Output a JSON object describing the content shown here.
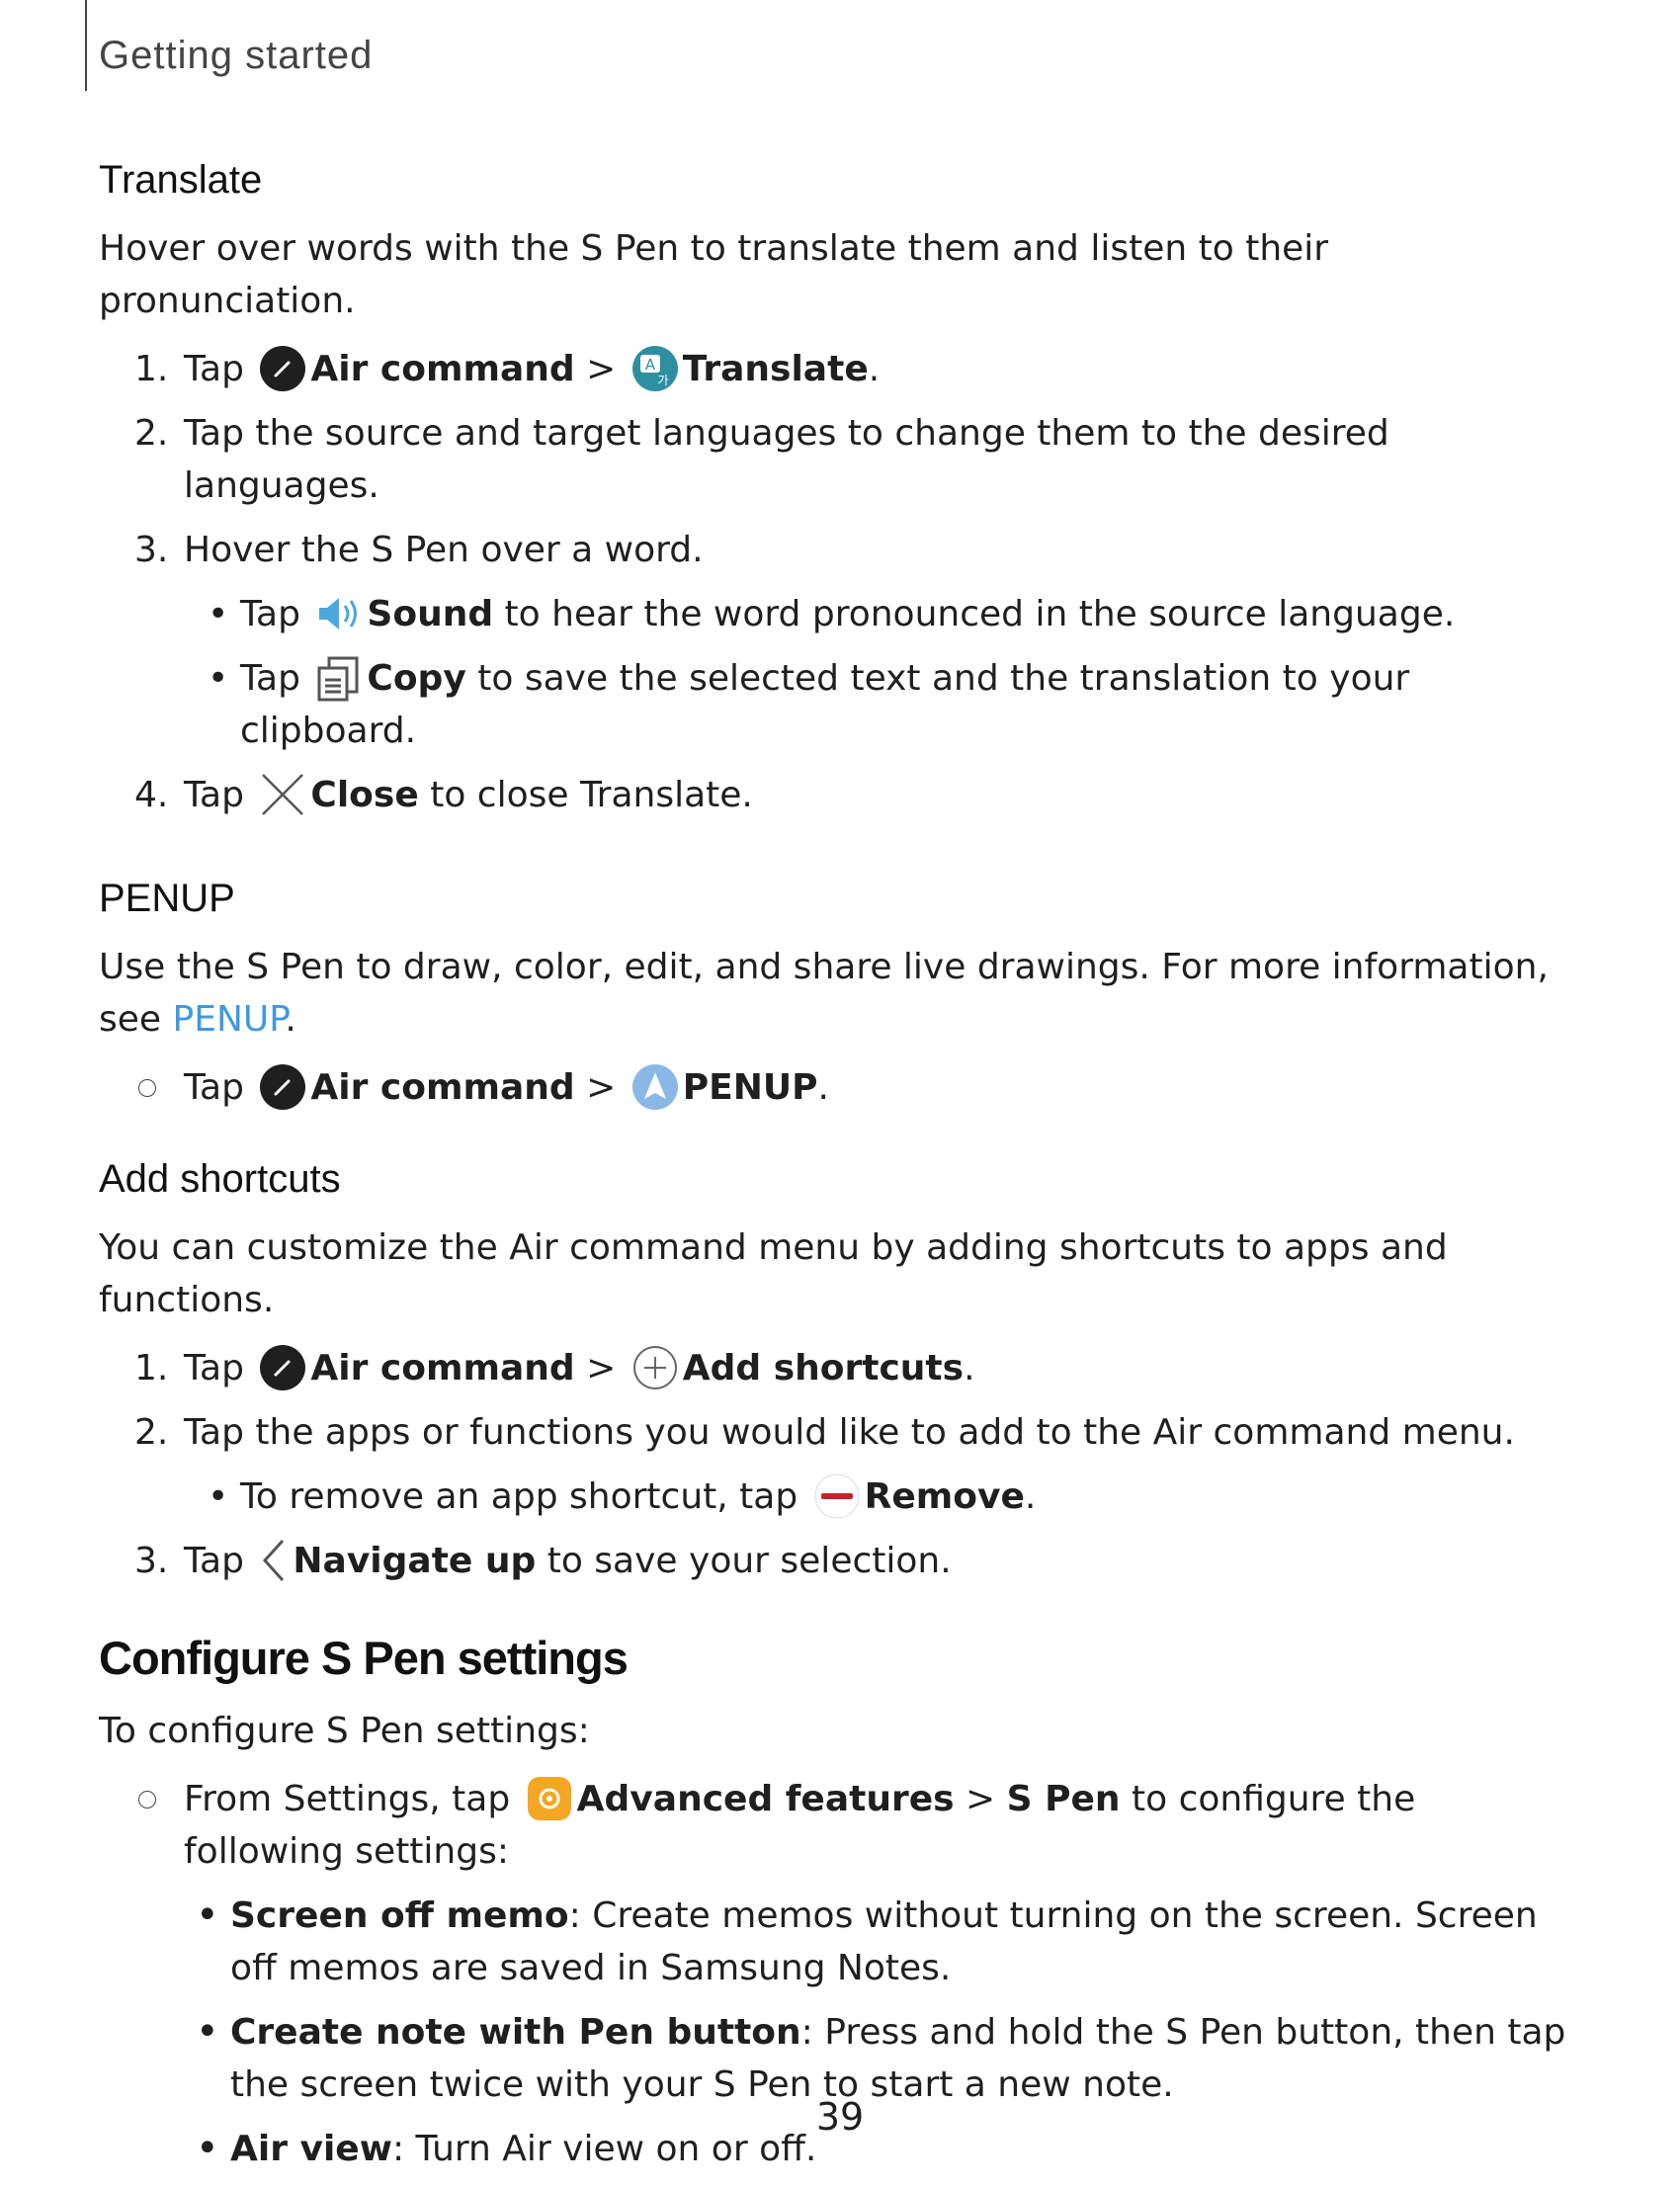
{
  "section_label": "Getting started",
  "translate": {
    "heading": "Translate",
    "intro": "Hover over words with the S Pen to translate them and listen to their pronunciation.",
    "step1": {
      "num": "1.",
      "tap": "Tap",
      "air_command": "Air command",
      "sep": ">",
      "target": "Translate",
      "end": "."
    },
    "step2": {
      "num": "2.",
      "text": "Tap the source and target languages to change them to the desired languages."
    },
    "step3": {
      "num": "3.",
      "text": "Hover the S Pen over a word."
    },
    "bullet_sound": {
      "dot": "•",
      "tap": "Tap",
      "label": "Sound",
      "rest": "to hear the word pronounced in the source language."
    },
    "bullet_copy": {
      "dot": "•",
      "tap": "Tap",
      "label": "Copy",
      "rest": "to save the selected text and the translation to your clipboard."
    },
    "step4": {
      "num": "4.",
      "tap": "Tap",
      "label": "Close",
      "rest": "to close Translate."
    }
  },
  "penup": {
    "heading": "PENUP",
    "intro": "Use the S Pen to draw, color, edit, and share live drawings. For more information, see",
    "link": "PENUP",
    "link_end": ".",
    "step": {
      "tap": "Tap",
      "air_command": "Air command",
      "sep": ">",
      "target": "PENUP",
      "end": "."
    }
  },
  "shortcuts": {
    "heading": "Add shortcuts",
    "intro": "You can customize the Air command menu by adding shortcuts to apps and functions.",
    "step1": {
      "num": "1.",
      "tap": "Tap",
      "air_command": "Air command",
      "sep": ">",
      "target": "Add shortcuts",
      "end": "."
    },
    "step2": {
      "num": "2.",
      "text": "Tap the apps or functions you would like to add to the Air command menu."
    },
    "bullet_remove": {
      "dot": "•",
      "text": "To remove an app shortcut, tap",
      "label": "Remove",
      "end": "."
    },
    "step3": {
      "num": "3.",
      "tap": "Tap",
      "label": "Navigate up",
      "rest": "to save your selection."
    }
  },
  "configure": {
    "heading": "Configure S Pen settings",
    "intro": "To configure S Pen settings:",
    "step": {
      "text": "From Settings, tap",
      "advanced": "Advanced features",
      "sep": ">",
      "spen": "S Pen",
      "rest": "to configure the following settings:"
    },
    "bullets": [
      {
        "dot": "•",
        "label": "Screen off memo",
        "text": ": Create memos without turning on the screen. Screen off memos are saved in Samsung Notes."
      },
      {
        "dot": "•",
        "label": "Create note with Pen button",
        "text": ": Press and hold the S Pen button, then tap the screen twice with your S Pen to start a new note."
      },
      {
        "dot": "•",
        "label": "Air view",
        "text": ": Turn Air view on or off."
      }
    ]
  },
  "page_number": "39",
  "colors": {
    "link": "#3e99e0",
    "remove": "#c0262c",
    "settings_icon": "#f5a623",
    "translate_icon": "#2f8fa0",
    "sound_icon": "#4aa8de"
  }
}
